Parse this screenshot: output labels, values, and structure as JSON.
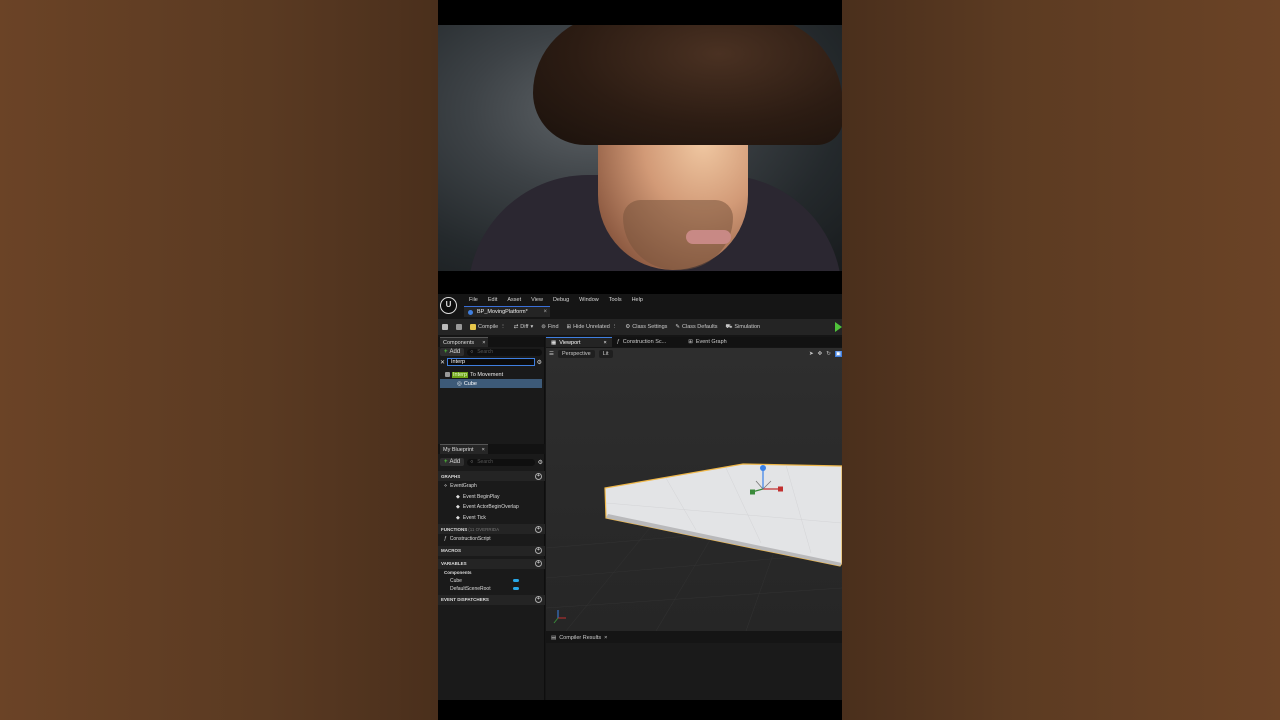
{
  "menu": [
    "File",
    "Edit",
    "Asset",
    "View",
    "Debug",
    "Window",
    "Tools",
    "Help"
  ],
  "document_tab": {
    "label": "BP_MovingPlatform*",
    "close": "×"
  },
  "toolbar": {
    "compile": "Compile",
    "diff": "Diff",
    "find": "Find",
    "hide_unrelated": "Hide Unrelated",
    "class_settings": "Class Settings",
    "class_defaults": "Class Defaults",
    "simulation": "Simulation"
  },
  "components_panel": {
    "tab": "Components",
    "close": "×",
    "add": "Add",
    "search_placeholder": "Search",
    "filter_value": "Interp",
    "tree": {
      "highlight": "Interp",
      "rest": "To Movement",
      "child": "Cube"
    }
  },
  "my_blueprint": {
    "tab": "My Blueprint",
    "close": "×",
    "add": "Add",
    "search_placeholder": "Search",
    "graphs_header": "GRAPHS",
    "event_graph": "EventGraph",
    "events": [
      "Event BeginPlay",
      "Event ActorBeginOverlap",
      "Event Tick"
    ],
    "functions_header": "FUNCTIONS",
    "functions_sub": "(11 OVERRIDA",
    "construction_script": "ConstructionScript",
    "macros_header": "MACROS",
    "variables_header": "VARIABLES",
    "components_label": "Components",
    "variables": [
      "Cube",
      "DefaultSceneRoot"
    ],
    "event_dispatchers_header": "EVENT DISPATCHERS"
  },
  "editor_tabs": [
    {
      "label": "Viewport",
      "close": "×"
    },
    {
      "label": "Construction Sc..."
    },
    {
      "label": "Event Graph"
    }
  ],
  "viewport": {
    "perspective": "Perspective",
    "lit": "Lit"
  },
  "compiler_results": {
    "tab": "Compiler Results",
    "close": "×"
  },
  "colors": {
    "accent": "#3f7fe0",
    "highlight": "#6ea318",
    "play": "#4fc23a",
    "platform_outline": "#f0b84a"
  }
}
